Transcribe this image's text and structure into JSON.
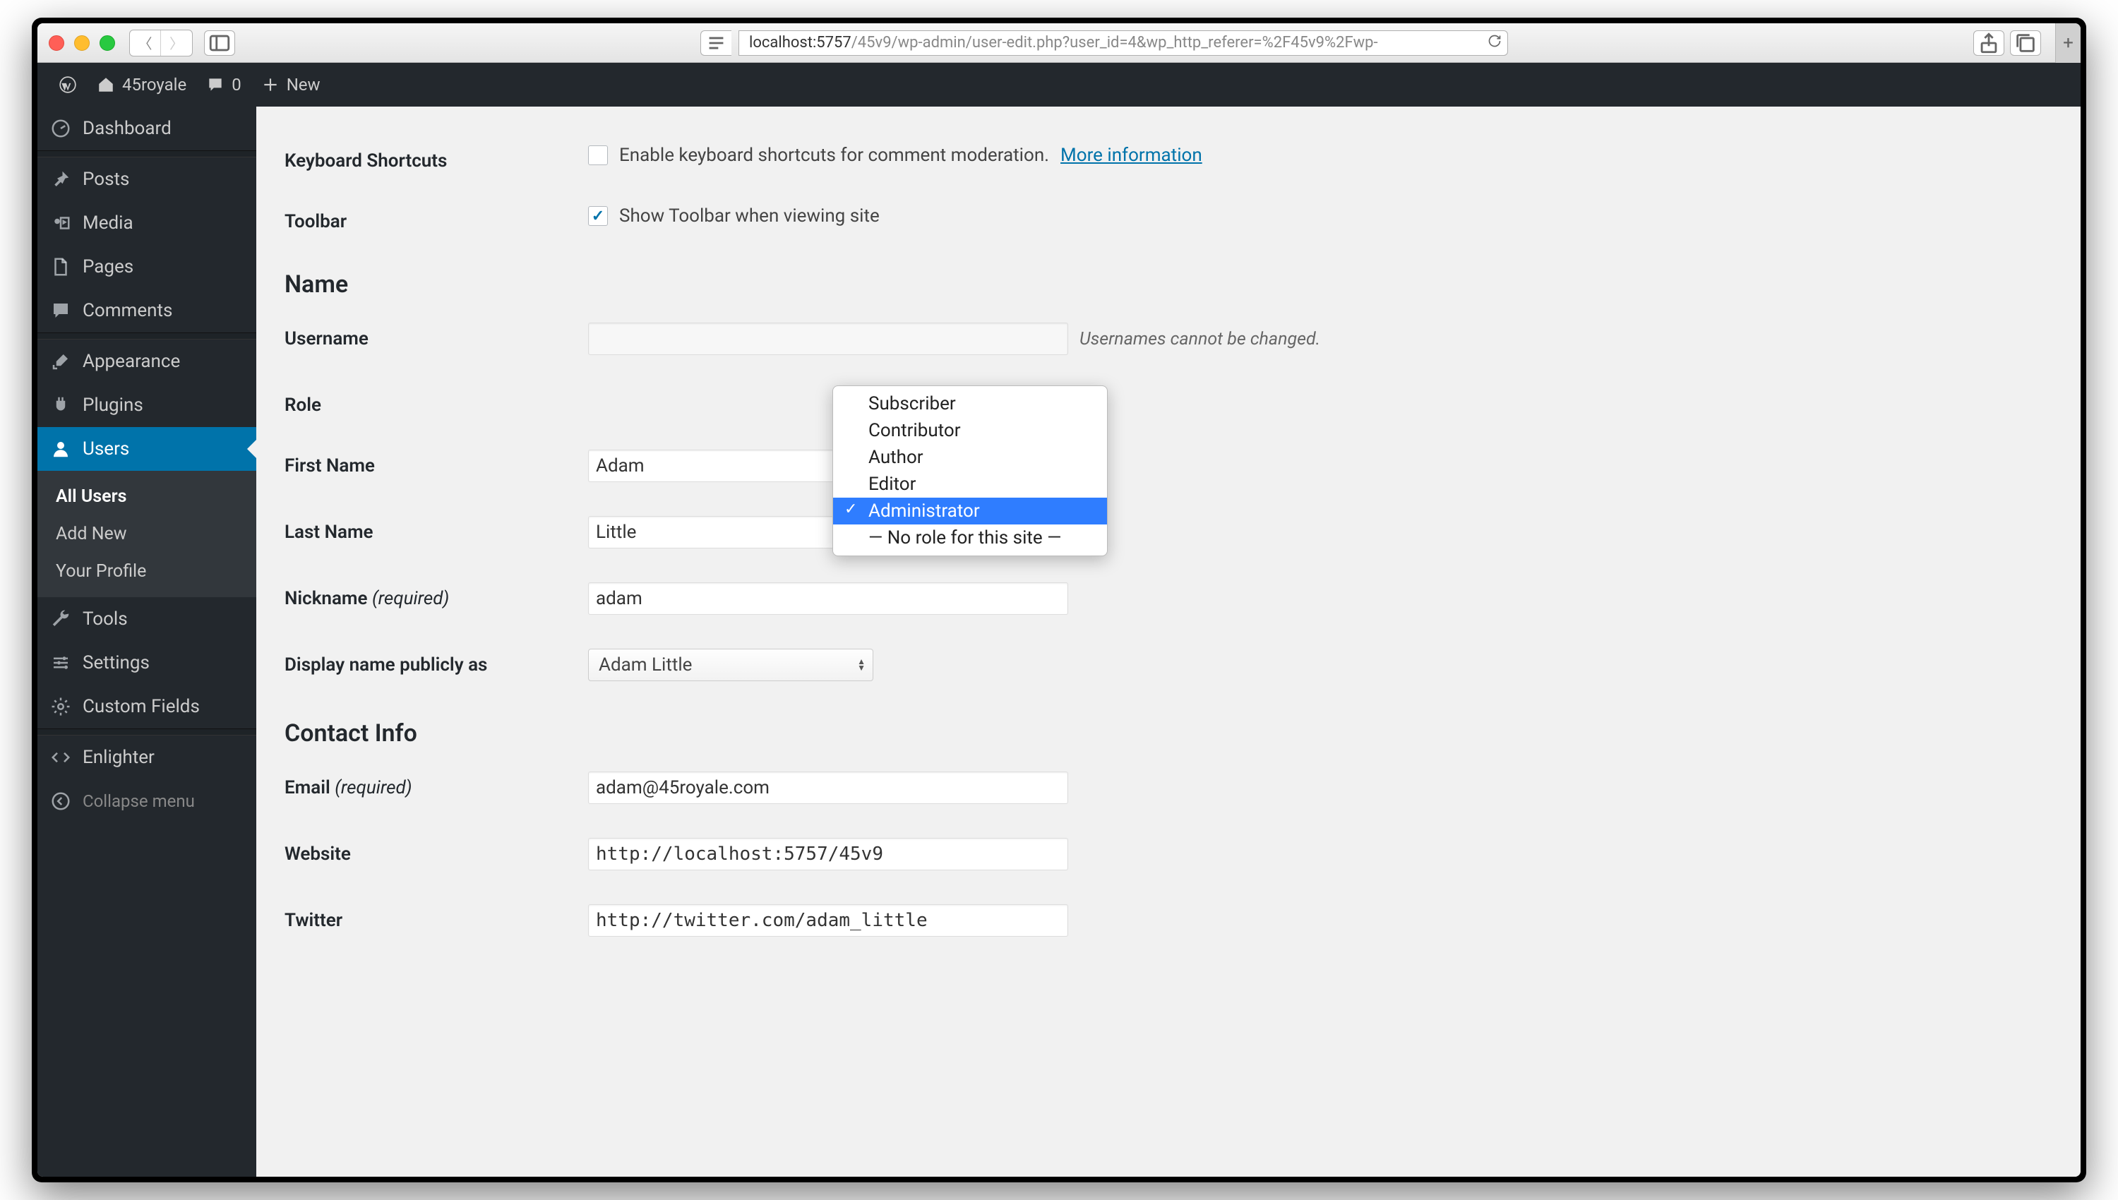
{
  "browser": {
    "url_host": "localhost:5757",
    "url_path": "/45v9/wp-admin/user-edit.php?user_id=4&wp_http_referer=%2F45v9%2Fwp-"
  },
  "adminbar": {
    "site_name": "45royale",
    "comment_count": "0",
    "new_label": "New"
  },
  "sidebar": {
    "items": [
      {
        "label": "Dashboard",
        "icon": "dashboard-icon"
      },
      {
        "label": "Posts",
        "icon": "pin-icon"
      },
      {
        "label": "Media",
        "icon": "media-icon"
      },
      {
        "label": "Pages",
        "icon": "page-icon"
      },
      {
        "label": "Comments",
        "icon": "comment-icon"
      },
      {
        "label": "Appearance",
        "icon": "brush-icon"
      },
      {
        "label": "Plugins",
        "icon": "plug-icon"
      },
      {
        "label": "Users",
        "icon": "user-icon"
      },
      {
        "label": "Tools",
        "icon": "wrench-icon"
      },
      {
        "label": "Settings",
        "icon": "sliders-icon"
      },
      {
        "label": "Custom Fields",
        "icon": "gear-icon"
      },
      {
        "label": "Enlighter",
        "icon": "code-icon"
      }
    ],
    "submenu": [
      {
        "label": "All Users"
      },
      {
        "label": "Add New"
      },
      {
        "label": "Your Profile"
      }
    ],
    "collapse_label": "Collapse menu"
  },
  "form": {
    "keyboard_shortcuts_label": "Keyboard Shortcuts",
    "keyboard_shortcuts_text": "Enable keyboard shortcuts for comment moderation.",
    "more_info": "More information",
    "toolbar_label": "Toolbar",
    "toolbar_text": "Show Toolbar when viewing site",
    "name_heading": "Name",
    "username_label": "Username",
    "username_note": "Usernames cannot be changed.",
    "role_label": "Role",
    "role_options": [
      "Subscriber",
      "Contributor",
      "Author",
      "Editor",
      "Administrator",
      "— No role for this site —"
    ],
    "role_selected": "Administrator",
    "firstname_label": "First Name",
    "firstname_value": "Adam",
    "lastname_label": "Last Name",
    "lastname_value": "Little",
    "nickname_label": "Nickname",
    "nickname_req": "(required)",
    "nickname_value": "adam",
    "displayname_label": "Display name publicly as",
    "displayname_value": "Adam Little",
    "contact_heading": "Contact Info",
    "email_label": "Email",
    "email_req": "(required)",
    "email_value": "adam@45royale.com",
    "website_label": "Website",
    "website_value": "http://localhost:5757/45v9",
    "twitter_label": "Twitter",
    "twitter_value": "http://twitter.com/adam_little"
  }
}
